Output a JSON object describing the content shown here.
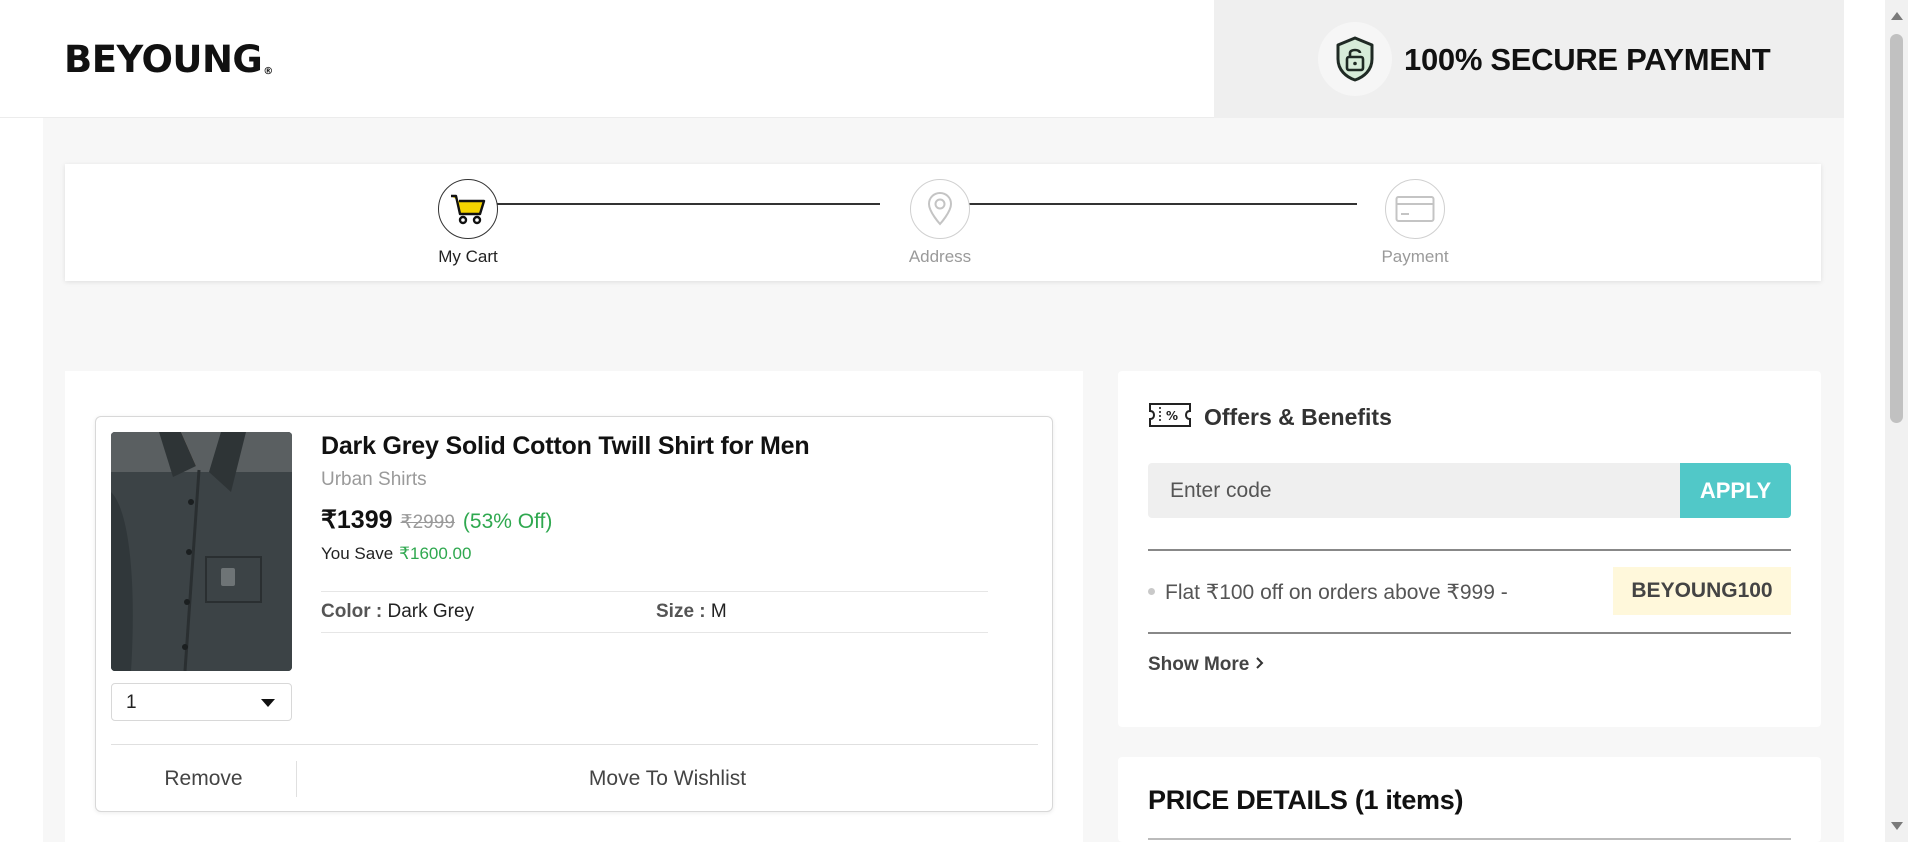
{
  "header": {
    "logo": "BEYOUNG",
    "logo_mark": "®",
    "secure_text": "100% SECURE PAYMENT"
  },
  "stepper": {
    "steps": [
      {
        "label": "My Cart",
        "state": "active",
        "icon": "cart-icon"
      },
      {
        "label": "Address",
        "state": "inactive",
        "icon": "location-pin-icon"
      },
      {
        "label": "Payment",
        "state": "inactive",
        "icon": "credit-card-icon"
      }
    ]
  },
  "cart": {
    "item": {
      "title": "Dark Grey Solid Cotton Twill Shirt for Men",
      "subtitle": "Urban Shirts",
      "price": "₹1399",
      "mrp": "₹2999",
      "discount": "(53% Off)",
      "save_label": "You Save",
      "save_amount": "₹1600.00",
      "color_key": "Color :",
      "color_value": "Dark Grey",
      "size_key": "Size :",
      "size_value": "M",
      "quantity": "1"
    },
    "actions": {
      "remove": "Remove",
      "wishlist": "Move To Wishlist"
    }
  },
  "offers": {
    "title": "Offers & Benefits",
    "input_placeholder": "Enter code",
    "apply_label": "APPLY",
    "offer_text": "Flat ₹100 off on orders above ₹999 -",
    "offer_code": "BEYOUNG100",
    "show_more": "Show More"
  },
  "price_details": {
    "title": "PRICE DETAILS (1 items)"
  },
  "colors": {
    "accent_teal": "#51c8c8",
    "success_green": "#2fa84f",
    "coupon_bg": "#fff8db",
    "cart_yellow": "#f5d400"
  }
}
